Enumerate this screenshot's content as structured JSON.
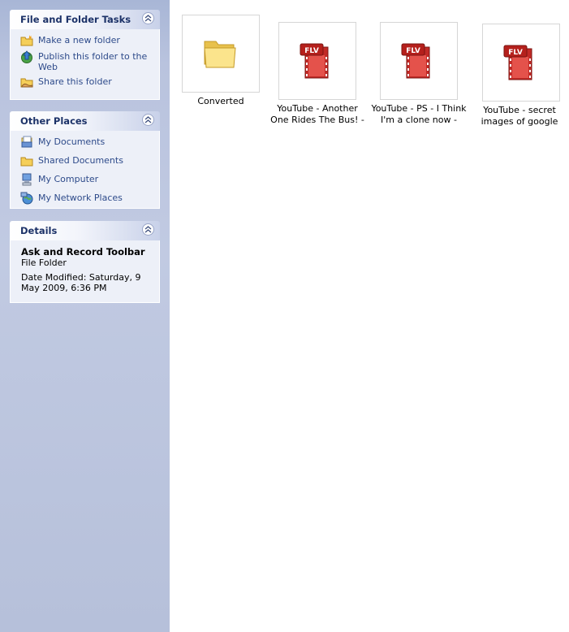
{
  "file_tasks": {
    "title": "File and Folder Tasks",
    "items": [
      {
        "label": "Make a new folder",
        "icon": "new-folder-icon"
      },
      {
        "label": "Publish this folder to the Web",
        "icon": "publish-web-icon"
      },
      {
        "label": "Share this folder",
        "icon": "share-folder-icon"
      }
    ]
  },
  "other_places": {
    "title": "Other Places",
    "items": [
      {
        "label": "My Documents",
        "icon": "my-documents-icon"
      },
      {
        "label": "Shared Documents",
        "icon": "shared-documents-icon"
      },
      {
        "label": "My Computer",
        "icon": "my-computer-icon"
      },
      {
        "label": "My Network Places",
        "icon": "network-places-icon"
      }
    ]
  },
  "details": {
    "title": "Details",
    "name": "Ask and Record Toolbar",
    "type": "File Folder",
    "modified": "Date Modified: Saturday, 9 May 2009, 6:36 PM"
  },
  "files": [
    {
      "name": "Converted",
      "kind": "folder",
      "icon": "folder-icon"
    },
    {
      "name": "YouTube - Another One Rides The Bus! -Weir…",
      "kind": "flv",
      "icon": "flv-file-icon",
      "badge": "FLV"
    },
    {
      "name": "YouTube - PS - I Think I'm a clone now - We…",
      "kind": "flv",
      "icon": "flv-file-icon",
      "badge": "FLV"
    },
    {
      "name": "YouTube - secret images of google earth",
      "kind": "flv",
      "icon": "flv-file-icon",
      "badge": "FLV"
    }
  ]
}
